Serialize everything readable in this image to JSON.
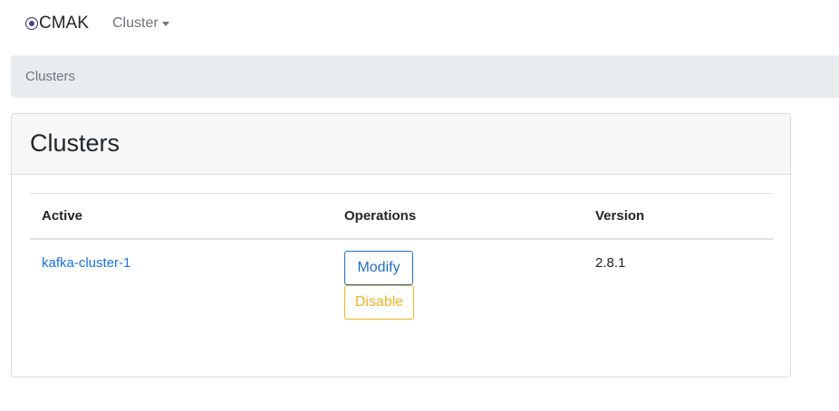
{
  "navbar": {
    "brand": "CMAK",
    "cluster_menu": "Cluster"
  },
  "breadcrumb": {
    "current": "Clusters"
  },
  "card": {
    "title": "Clusters"
  },
  "table": {
    "headers": {
      "active": "Active",
      "operations": "Operations",
      "version": "Version"
    },
    "rows": [
      {
        "name": "kafka-cluster-1",
        "modify_label": "Modify",
        "disable_label": "Disable",
        "version": "2.8.1"
      }
    ]
  },
  "colors": {
    "link": "#1a73e8",
    "modify": "#1f6fbf",
    "disable": "#f0b323",
    "breadcrumb_bg": "#e9ecef",
    "card_header_bg": "#f7f7f7"
  },
  "icons": {
    "brand": "cmak-logo-icon",
    "dropdown": "caret-down-icon"
  }
}
